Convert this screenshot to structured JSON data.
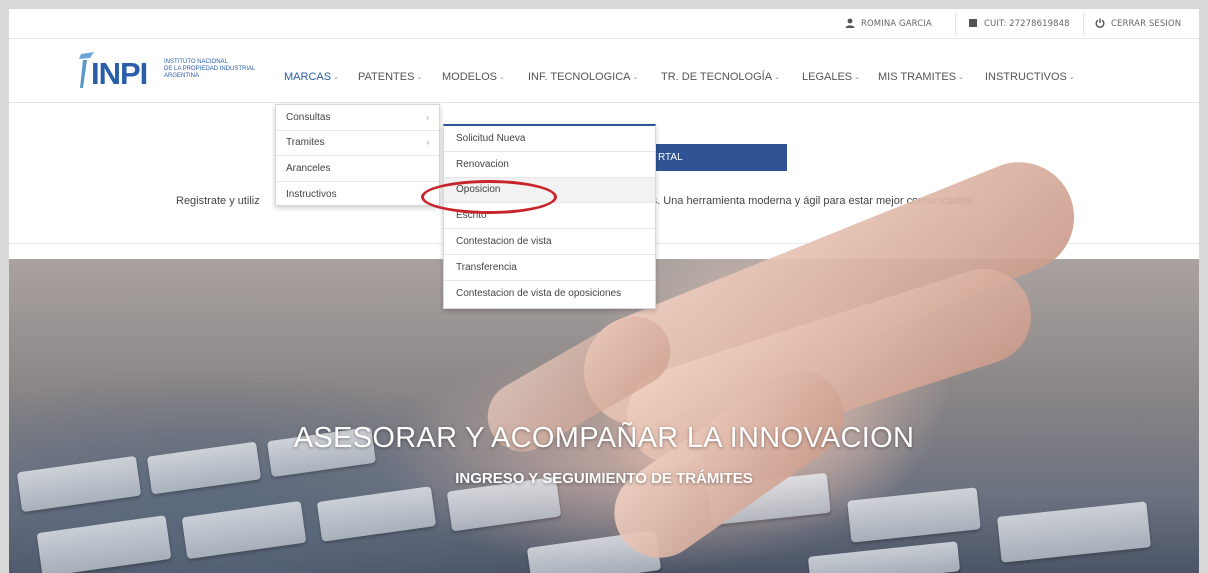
{
  "userbar": {
    "user_name": "ROMINA GARCIA",
    "cuit": "CUIT: 27278619848",
    "logout": "CERRAR SESION"
  },
  "logo": {
    "mark": "INPI",
    "line1": "INSTITUTO NACIONAL",
    "line2": "DE LA PROPIEDAD INDUSTRIAL",
    "line3": "ARGENTINA"
  },
  "nav": {
    "items": [
      {
        "label": "MARCAS"
      },
      {
        "label": "PATENTES"
      },
      {
        "label": "MODELOS"
      },
      {
        "label": "INF. TECNOLOGICA"
      },
      {
        "label": "TR. DE TECNOLOGÍA"
      },
      {
        "label": "LEGALES"
      },
      {
        "label": "MIS TRAMITES"
      },
      {
        "label": "INSTRUCTIVOS"
      }
    ]
  },
  "intro": {
    "button_label": "RTAL",
    "text_left": "Registrate y utiliz",
    "text_right": "ites. Una herramienta moderna y ágil para estar mejor comunicados."
  },
  "marcas_menu": {
    "items": [
      {
        "label": "Consultas",
        "arrow": "›"
      },
      {
        "label": "Tramites",
        "arrow": "›"
      },
      {
        "label": "Aranceles",
        "arrow": ""
      },
      {
        "label": "Instructivos",
        "arrow": ""
      }
    ]
  },
  "tramites_menu": {
    "items": [
      {
        "label": "Solicitud Nueva"
      },
      {
        "label": "Renovacion"
      },
      {
        "label": "Oposicion"
      },
      {
        "label": "Escrito"
      },
      {
        "label": "Contestacion de vista"
      },
      {
        "label": "Transferencia"
      },
      {
        "label": "Contestacion de vista de oposiciones"
      }
    ]
  },
  "hero": {
    "title": "ASESORAR Y ACOMPAÑAR LA INNOVACION",
    "subtitle": "INGRESO Y SEGUIMIENTO DE TRÁMITES"
  },
  "colors": {
    "brand_blue": "#2f5395",
    "highlight_red": "#c8252b"
  }
}
